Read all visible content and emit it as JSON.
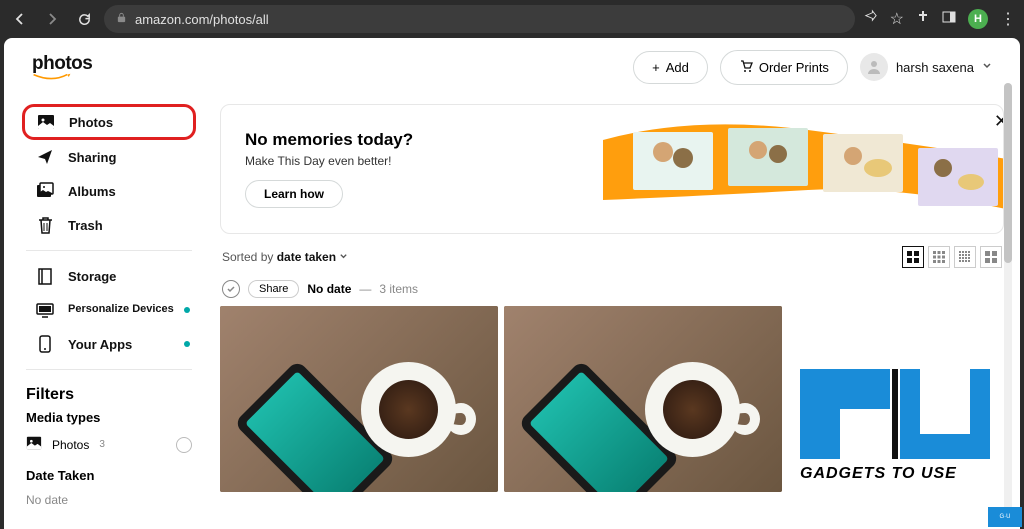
{
  "browser": {
    "url": "amazon.com/photos/all",
    "profile_initial": "H"
  },
  "header": {
    "logo": "photos",
    "add_label": "Add",
    "order_prints_label": "Order Prints",
    "user_name": "harsh saxena"
  },
  "sidebar": {
    "items": [
      {
        "label": "Photos",
        "icon": "image"
      },
      {
        "label": "Sharing",
        "icon": "send"
      },
      {
        "label": "Albums",
        "icon": "album"
      },
      {
        "label": "Trash",
        "icon": "trash"
      }
    ],
    "items2": [
      {
        "label": "Storage",
        "icon": "book",
        "dot": false
      },
      {
        "label": "Personalize Devices",
        "icon": "monitor",
        "dot": true
      },
      {
        "label": "Your Apps",
        "icon": "phone",
        "dot": true
      }
    ]
  },
  "filters": {
    "title": "Filters",
    "media_types_label": "Media types",
    "photos_label": "Photos",
    "photos_count": "3",
    "date_taken_label": "Date Taken",
    "no_date_label": "No date"
  },
  "banner": {
    "title": "No memories today?",
    "subtitle": "Make This Day even better!",
    "button": "Learn how"
  },
  "sort": {
    "prefix": "Sorted by ",
    "value": "date taken"
  },
  "group": {
    "share_label": "Share",
    "title": "No date",
    "separator": "—",
    "count": "3 items"
  },
  "watermark": {
    "text": "GADGETS TO USE"
  }
}
